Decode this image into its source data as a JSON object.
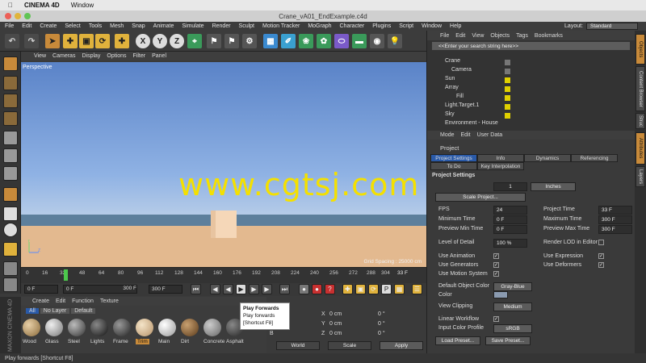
{
  "mac_menu": {
    "app": "CINEMA 4D",
    "window": "Window"
  },
  "window_title": "Crane_vA01_EndExample.c4d",
  "menu": [
    "File",
    "Edit",
    "Create",
    "Select",
    "Tools",
    "Mesh",
    "Snap",
    "Animate",
    "Simulate",
    "Render",
    "Sculpt",
    "Motion Tracker",
    "MoGraph",
    "Character",
    "Plugins",
    "Script",
    "Window",
    "Help"
  ],
  "layout": {
    "label": "Layout:",
    "value": "Standard"
  },
  "toolbar": {
    "x": "X",
    "y": "Y",
    "z": "Z"
  },
  "viewport": {
    "menu": [
      "View",
      "Cameras",
      "Display",
      "Options",
      "Filter",
      "Panel"
    ],
    "label": "Perspective",
    "grid_spacing": "Grid Spacing : 25000 cm",
    "watermark": "www.cgtsj.com",
    "axis_y": "Y",
    "axis_z": "Z"
  },
  "timeline": {
    "ticks": [
      "0",
      "16",
      "32",
      "48",
      "64",
      "80",
      "96",
      "112",
      "128",
      "144",
      "160",
      "176",
      "192",
      "208",
      "224",
      "240",
      "256",
      "272",
      "288",
      "304"
    ],
    "current_frame": "33 F",
    "start": "0 F",
    "range_start": "0 F",
    "range_end": "300 F",
    "end": "300 F"
  },
  "tooltip": {
    "title": "Play Forwards",
    "desc": "Play forwards",
    "shortcut": "[Shortcut F8]"
  },
  "materials": {
    "menu": [
      "Create",
      "Edit",
      "Function",
      "Texture"
    ],
    "filters": [
      "All",
      "No Layer",
      "Default"
    ],
    "items": [
      "Wood",
      "Glass",
      "Steel",
      "Lights",
      "Frame",
      "Trim",
      "Main",
      "Dirt",
      "Concrete",
      "Asphalt"
    ]
  },
  "coords": {
    "rows": [
      {
        "x": "0 cm",
        "h": "0 °"
      },
      {
        "x": "0 cm",
        "h": "0 °"
      },
      {
        "x": "0 cm",
        "h": "0 °"
      }
    ],
    "p_labels": [
      "P",
      "P",
      "B"
    ],
    "axes": [
      "X",
      "Y",
      "Z"
    ],
    "world": "World",
    "scale": "Scale",
    "apply": "Apply"
  },
  "object_manager": {
    "menu": [
      "File",
      "Edit",
      "View",
      "Objects",
      "Tags",
      "Bookmarks"
    ],
    "search_placeholder": "<<Enter your search string here>>",
    "objects": [
      "Crane",
      "Camera",
      "Sun",
      "Array",
      "Fill",
      "Light.Target.1",
      "Sky",
      "Environment - House"
    ]
  },
  "attributes": {
    "menu": [
      "Mode",
      "Edit",
      "User Data"
    ],
    "title": "Project",
    "tabs": [
      "Project Settings",
      "Info",
      "Dynamics",
      "Referencing"
    ],
    "subtabs": [
      "To Do",
      "Key Interpolation"
    ],
    "section": "Project Settings",
    "scale_value": "1",
    "scale_unit": "Inches",
    "scale_project": "Scale Project...",
    "fps_label": "FPS",
    "fps": "24",
    "project_time_label": "Project Time",
    "project_time": "33 F",
    "min_time_label": "Minimum Time",
    "min_time": "0 F",
    "max_time_label": "Maximum Time",
    "max_time": "300 F",
    "prev_min_label": "Preview Min Time",
    "prev_min": "0 F",
    "prev_max_label": "Preview Max Time",
    "prev_max": "300 F",
    "lod_label": "Level of Detail",
    "lod": "100 %",
    "render_lod_label": "Render LOD in Editor",
    "use_animation": "Use Animation",
    "use_expression": "Use Expression",
    "use_generators": "Use Generators",
    "use_deformers": "Use Deformers",
    "use_motion": "Use Motion System",
    "default_color_label": "Default Object Color",
    "default_color": "Gray-Blue",
    "color_label": "Color",
    "view_clipping_label": "View Clipping",
    "view_clipping": "Medium",
    "linear_workflow_label": "Linear Workflow",
    "input_profile_label": "Input Color Profile",
    "input_profile": "sRGB",
    "load_preset": "Load Preset...",
    "save_preset": "Save Preset..."
  },
  "right_tabs": [
    "Objects",
    "Content Browser",
    "Struc",
    "Attributes",
    "Layers"
  ],
  "status": "Play forwards [Shortcut F8]",
  "maxon": "MAXON CINEMA 4D",
  "colors": {
    "accent": "#c88a3a",
    "watermark": "#f4e000",
    "sky": "#8fb2e4",
    "ground": "#e3b98f"
  }
}
